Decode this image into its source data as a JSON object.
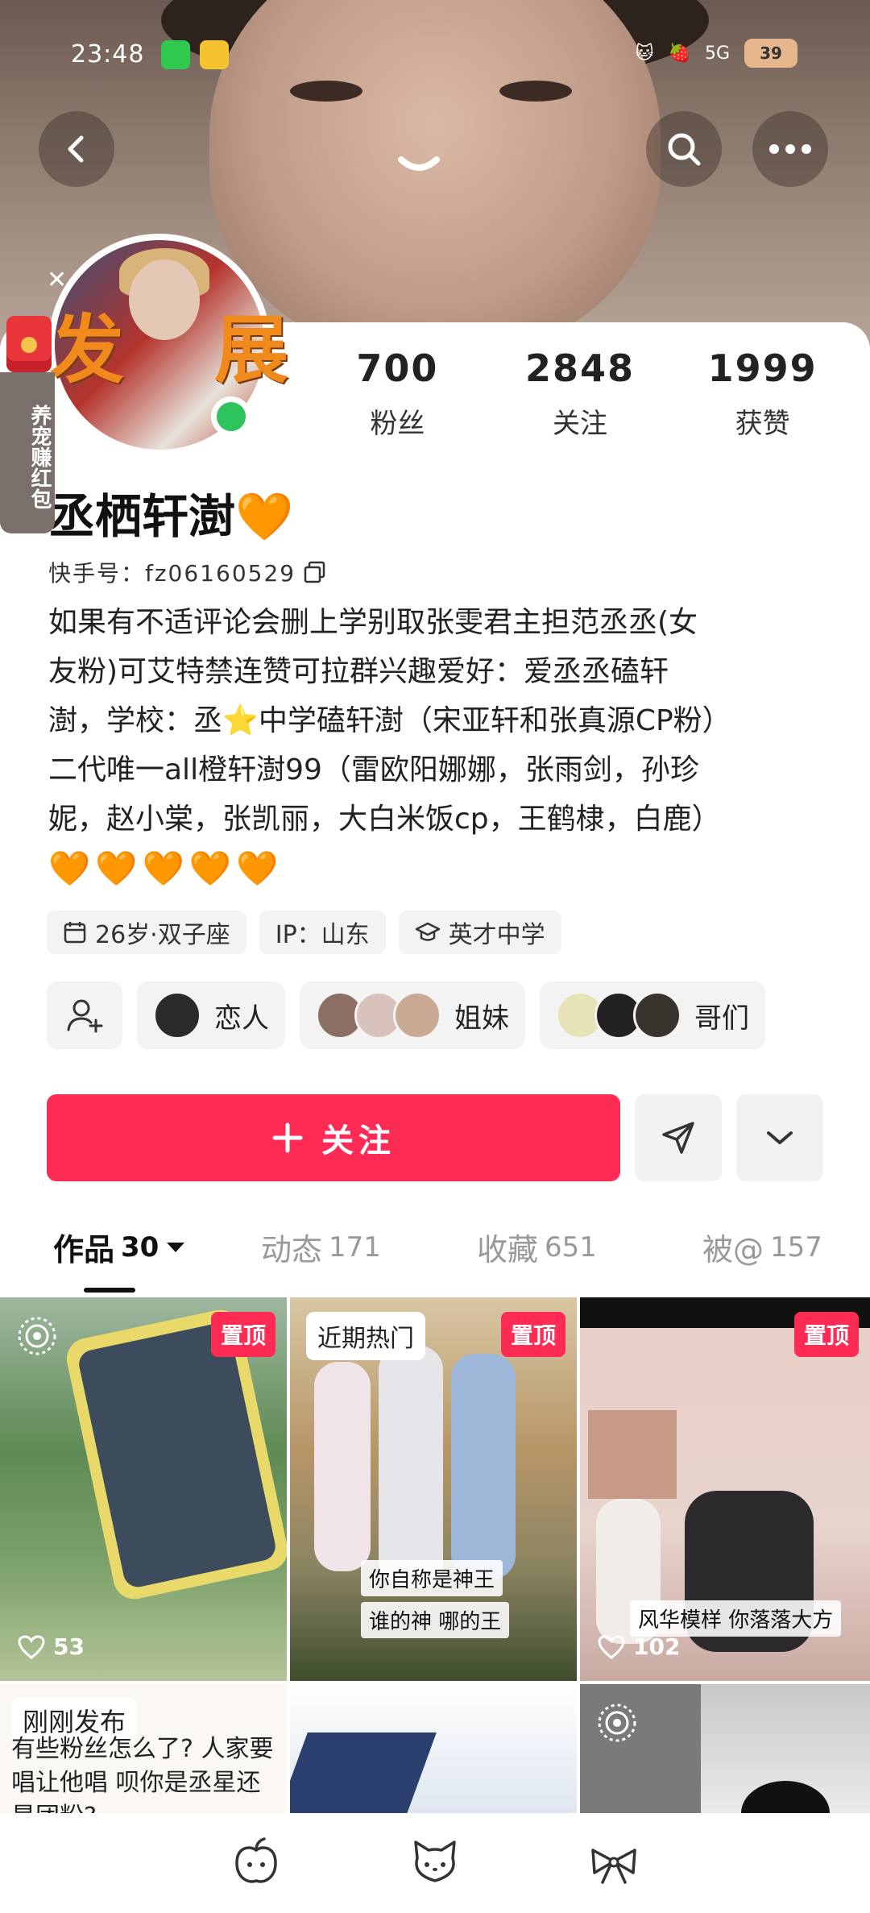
{
  "status_bar": {
    "time": "23:48",
    "network": "5G",
    "battery": "39"
  },
  "profile": {
    "name": "丞栖轩澍🧡",
    "kuaishou_id": "快手号：fz06160529",
    "avatar_overlay_text": "发 展",
    "stats": [
      {
        "value": "700",
        "label": "粉丝"
      },
      {
        "value": "2848",
        "label": "关注"
      },
      {
        "value": "1999",
        "label": "获赞"
      }
    ],
    "bio_lines": [
      "如果有不适评论会删上学别取张雯君主担范丞丞(女",
      "友粉)可艾特禁连赞可拉群兴趣爱好：爱丞丞磕轩",
      "澍，学校：丞⭐中学磕轩澍（宋亚轩和张真源CP粉）",
      "二代唯一all橙轩澍99（雷欧阳娜娜，张雨剑，孙珍",
      "妮，赵小棠，张凯丽，大白米饭cp，王鹤棣，白鹿）"
    ],
    "bio_hearts": "🧡🧡🧡🧡🧡",
    "chips": [
      {
        "icon": "calendar-icon",
        "text": "26岁·双子座"
      },
      {
        "icon": "",
        "text": "IP：山东"
      },
      {
        "icon": "school-icon",
        "text": "英才中学"
      }
    ],
    "relations": [
      {
        "label": "恋人"
      },
      {
        "label": "姐妹"
      },
      {
        "label": "哥们"
      }
    ]
  },
  "side_promo": {
    "text": "养宠赚红包"
  },
  "actions": {
    "follow_label": "关注"
  },
  "tabs": [
    {
      "label": "作品",
      "count": "30",
      "active": true
    },
    {
      "label": "动态",
      "count": "171",
      "active": false
    },
    {
      "label": "收藏",
      "count": "651",
      "active": false
    },
    {
      "label": "被@",
      "count": "157",
      "active": false
    }
  ],
  "grid": {
    "pinned_label": "置顶",
    "hot_label": "近期热门",
    "recent_label": "刚刚发布",
    "items": [
      {
        "likes": "53"
      },
      {
        "caption1": "你自称是神王",
        "caption2": "谁的神 哪的王"
      },
      {
        "likes": "102",
        "caption": "风华模样 你落落大方"
      }
    ],
    "row2_text": "有些粉丝怎么了? 人家要唱让他唱 呗你是丞星还是团粉?"
  },
  "colors": {
    "accent": "#fe2c55",
    "heart": "#f5a623",
    "online": "#2dc35d"
  }
}
